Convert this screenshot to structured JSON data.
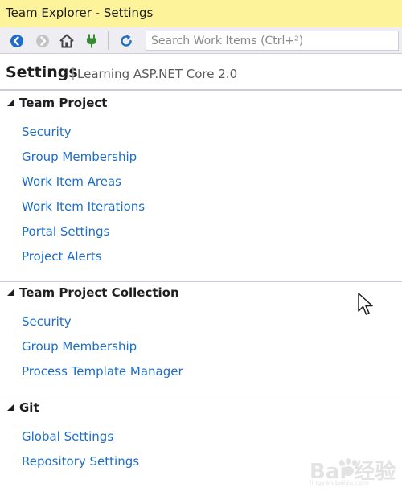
{
  "window": {
    "title": "Team Explorer - Settings"
  },
  "toolbar": {
    "buttons": [
      {
        "name": "back",
        "icon": "back-arrow-icon",
        "color": "#1e6ec8"
      },
      {
        "name": "forward",
        "icon": "forward-arrow-icon",
        "color": "#b4b4b4"
      },
      {
        "name": "home",
        "icon": "home-icon",
        "color": "#424242"
      },
      {
        "name": "connect",
        "icon": "plug-icon",
        "color": "#388a34"
      },
      {
        "name": "refresh",
        "icon": "refresh-icon",
        "color": "#1e6ec8"
      }
    ],
    "search": {
      "placeholder": "Search Work Items (Ctrl+²)",
      "value": ""
    }
  },
  "header": {
    "title": "Settings",
    "separator": "|",
    "subtitle": "Learning ASP.NET Core 2.0"
  },
  "sections": [
    {
      "title": "Team Project",
      "expanded": true,
      "links": [
        "Security",
        "Group Membership",
        "Work Item Areas",
        "Work Item Iterations",
        "Portal Settings",
        "Project Alerts"
      ]
    },
    {
      "title": "Team Project Collection",
      "expanded": true,
      "links": [
        "Security",
        "Group Membership",
        "Process Template Manager"
      ]
    },
    {
      "title": "Git",
      "expanded": true,
      "links": [
        "Global Settings",
        "Repository Settings"
      ]
    }
  ],
  "watermark": {
    "brand": "Bai  经验",
    "url": "jingyan.baidu.com"
  },
  "colors": {
    "title_bar": "#fdf39b",
    "toolbar_bg": "#eeeef2",
    "link": "#1e6ec8",
    "divider": "#cccedb"
  }
}
